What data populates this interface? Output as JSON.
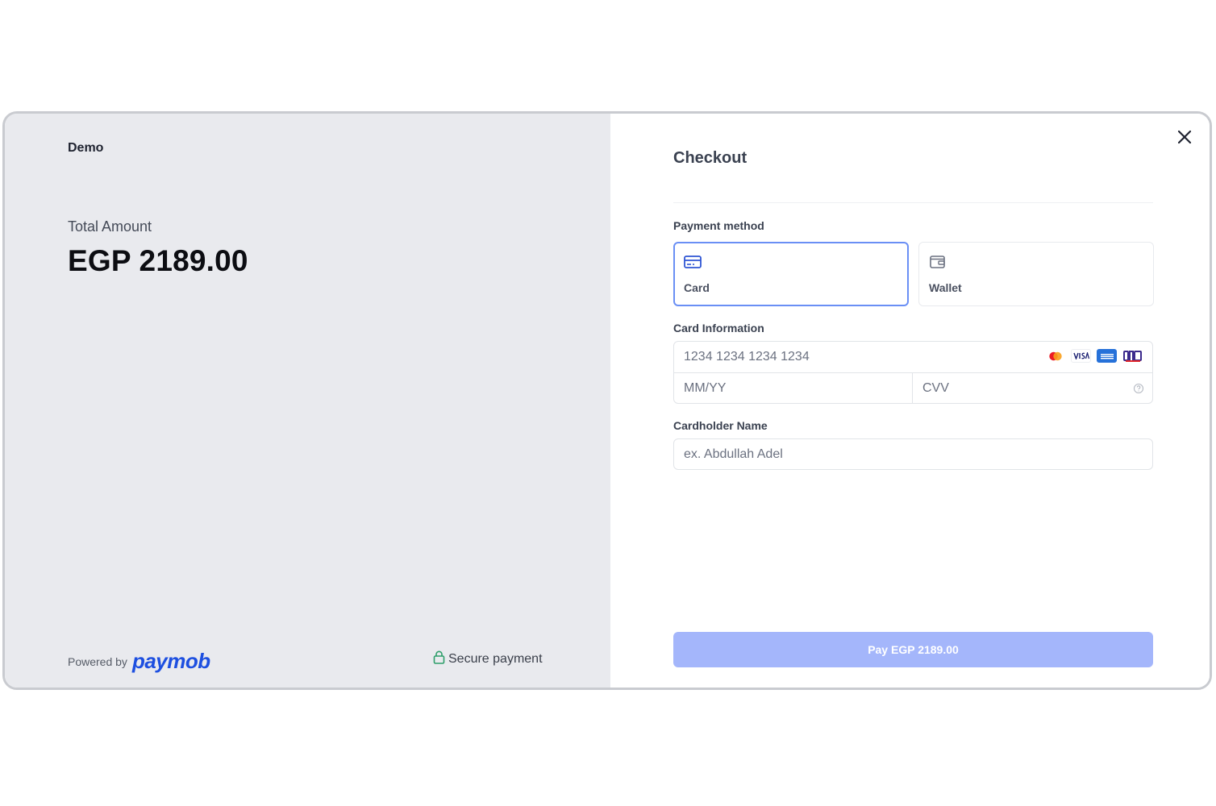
{
  "summary": {
    "merchant": "Demo",
    "total_label": "Total Amount",
    "total_amount": "EGP 2189.00",
    "powered_by": "Powered by",
    "brand": "paymob",
    "secure_label": "Secure payment"
  },
  "checkout": {
    "title": "Checkout",
    "payment_method_label": "Payment method",
    "methods": [
      {
        "label": "Card",
        "icon": "credit-card-icon",
        "selected": true
      },
      {
        "label": "Wallet",
        "icon": "wallet-icon",
        "selected": false
      }
    ],
    "card_info_label": "Card Information",
    "card_number_placeholder": "1234 1234 1234 1234",
    "expiry_placeholder": "MM/YY",
    "cvv_placeholder": "CVV",
    "card_brands": [
      "mastercard-icon",
      "visa-icon",
      "amex-icon",
      "meeza-icon"
    ],
    "cardholder_label": "Cardholder Name",
    "cardholder_placeholder": "ex. Abdullah Adel",
    "pay_button": "Pay EGP 2189.00"
  },
  "colors": {
    "accent": "#6a8ff5",
    "pay_button": "#a4b6fb",
    "left_panel": "#e9eaee",
    "brand_blue": "#1d4fe0",
    "secure_green": "#2e9e6a"
  }
}
